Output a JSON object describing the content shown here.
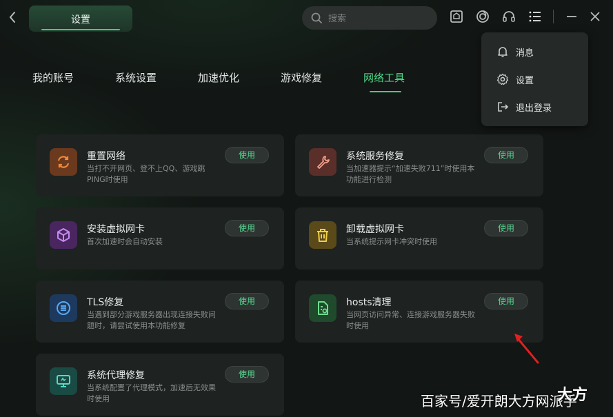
{
  "header": {
    "title": "设置",
    "search_placeholder": "搜索"
  },
  "tabs": [
    {
      "label": "我的账号",
      "active": false
    },
    {
      "label": "系统设置",
      "active": false
    },
    {
      "label": "加速优化",
      "active": false
    },
    {
      "label": "游戏修复",
      "active": false
    },
    {
      "label": "网络工具",
      "active": true
    }
  ],
  "menu": {
    "items": [
      {
        "label": "消息",
        "icon": "bell-icon"
      },
      {
        "label": "设置",
        "icon": "gear-icon"
      },
      {
        "label": "退出登录",
        "icon": "logout-icon"
      }
    ]
  },
  "cards": [
    {
      "title": "重置网络",
      "desc": "当打不开网页、登不上QQ、游戏跳PING时使用",
      "button": "使用",
      "icon": "refresh-icon",
      "icon_bg": "#6b3a1e",
      "icon_color": "#f08a3a"
    },
    {
      "title": "系统服务修复",
      "desc": "当加速器提示“加速失败711”时使用本功能进行检测",
      "button": "使用",
      "icon": "wrench-icon",
      "icon_bg": "#5a2f2a",
      "icon_color": "#f3a08a"
    },
    {
      "title": "安装虚拟网卡",
      "desc": "首次加速时会自动安装",
      "button": "使用",
      "icon": "cube-icon",
      "icon_bg": "#4a2660",
      "icon_color": "#c58af0"
    },
    {
      "title": "卸载虚拟网卡",
      "desc": "当系统提示网卡冲突时使用",
      "button": "使用",
      "icon": "trash-icon",
      "icon_bg": "#5a4a1a",
      "icon_color": "#f0cf4a"
    },
    {
      "title": "TLS修复",
      "desc": "当遇到部分游戏服务器出现连接失败问题时，请尝试使用本功能修复",
      "button": "使用",
      "icon": "tls-icon",
      "icon_bg": "#1d3a5e",
      "icon_color": "#5aa8f0"
    },
    {
      "title": "hosts清理",
      "desc": "当网页访问异常、连接游戏服务器失败时使用",
      "button": "使用",
      "icon": "file-clean-icon",
      "icon_bg": "#1f4a2c",
      "icon_color": "#6fdc8c"
    },
    {
      "title": "系统代理修复",
      "desc": "当系统配置了代理模式，加速后无效果时使用",
      "button": "使用",
      "icon": "monitor-icon",
      "icon_bg": "#1a4a44",
      "icon_color": "#5ad8c4"
    }
  ],
  "watermark": {
    "text": "百家号/爱开朗大方网派手",
    "logo": "大方"
  },
  "colors": {
    "accent": "#3fd07a",
    "arrow": "#e02020"
  }
}
